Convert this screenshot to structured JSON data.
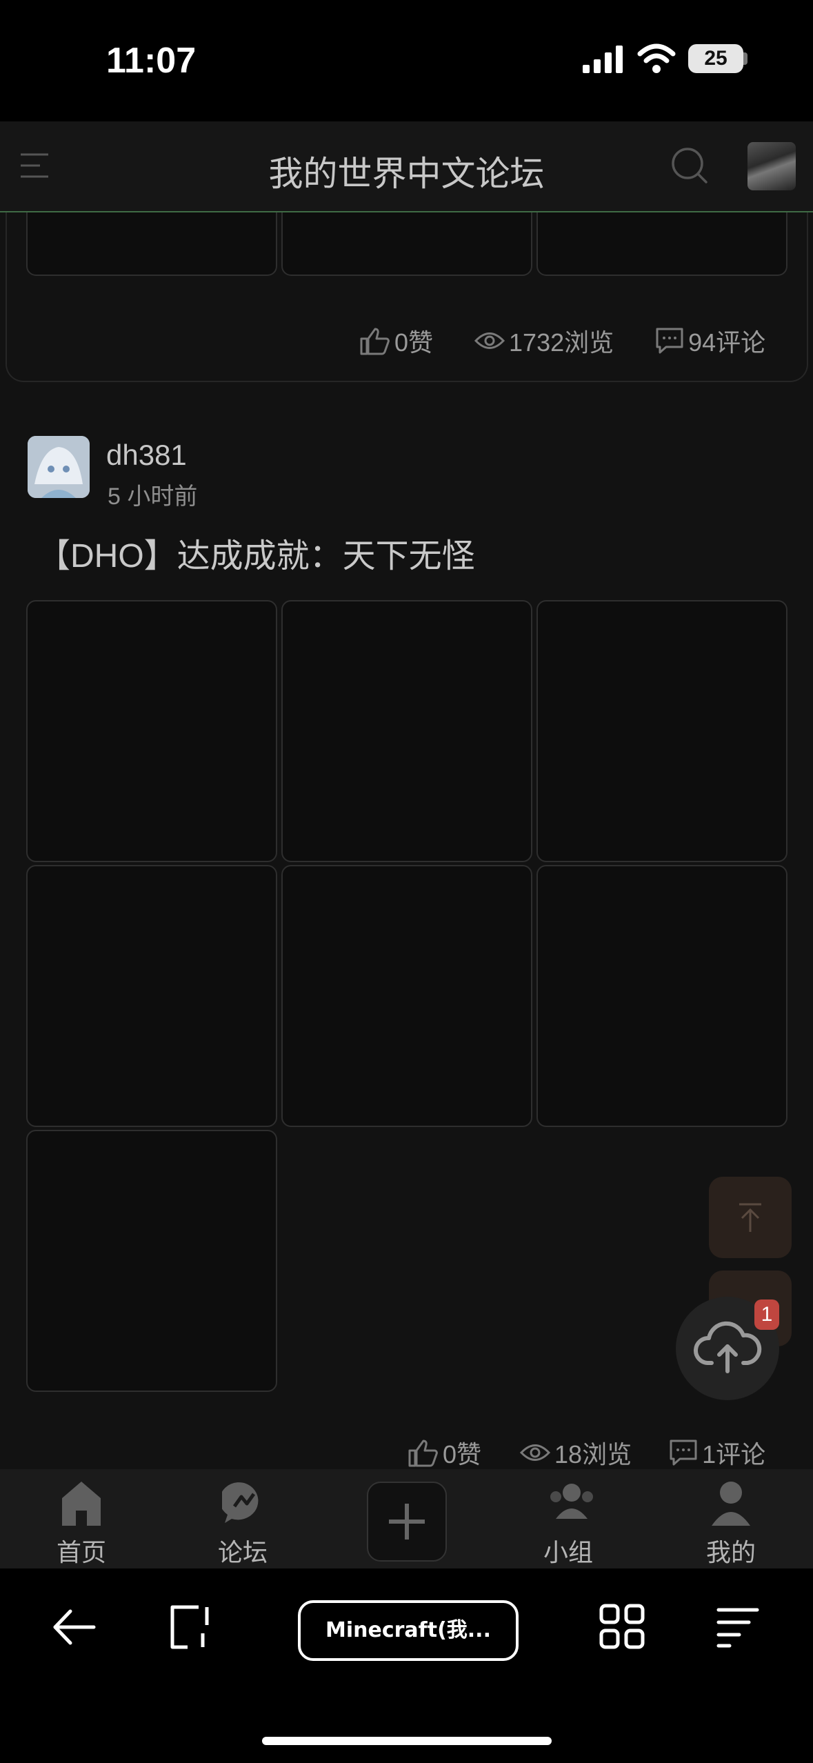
{
  "status_bar": {
    "time": "11:07",
    "battery": "25"
  },
  "header": {
    "title": "我的世界中文论坛"
  },
  "prev_post": {
    "likes": "0赞",
    "views": "1732浏览",
    "comments": "94评论"
  },
  "post": {
    "username": "dh381",
    "time": "5 小时前",
    "title": "【DHO】达成成就：天下无怪",
    "likes": "0赞",
    "views": "18浏览",
    "comments": "1评论"
  },
  "upload_badge": "1",
  "tabbar": {
    "home": "首页",
    "forum": "论坛",
    "groups": "小组",
    "mine": "我的"
  },
  "browser": {
    "url_label": "Minecraft(我..."
  }
}
